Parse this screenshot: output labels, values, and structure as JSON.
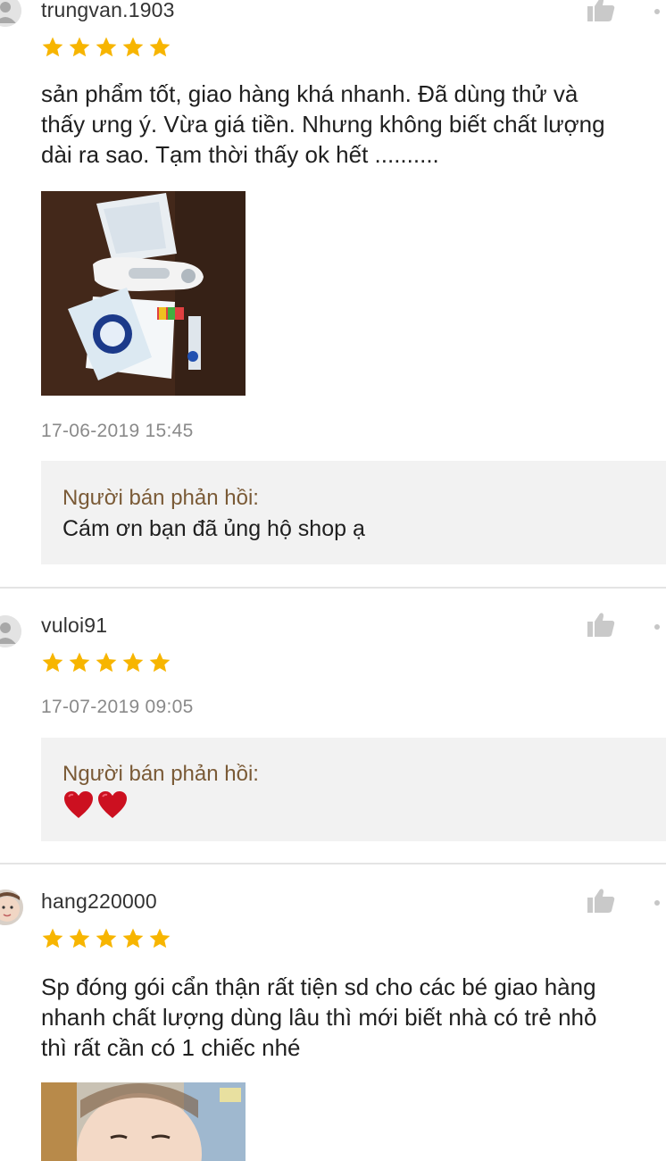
{
  "colors": {
    "star": "#f7b500",
    "seller_label": "#7a5a36",
    "timestamp": "#8a8a8a",
    "seller_box_bg": "#f2f2f2",
    "heart": "#cc1020"
  },
  "reviews": [
    {
      "username": "trungvan.1903",
      "rating": 5,
      "comment_lines": [
        "sản phẩm tốt, giao hàng khá nhanh. Đã dùng thử và",
        "thấy ưng ý. Vừa giá tiền. Nhưng không biết chất lượng",
        "dài ra sao. Tạm thời thấy ok hết .........."
      ],
      "photo_icon": "thermometer-product-photo",
      "timestamp": "17-06-2019 15:45",
      "seller_reply": {
        "label": "Người bán phản hồi:",
        "text": "Cám ơn bạn đã ủng hộ shop ạ"
      }
    },
    {
      "username": "vuloi91",
      "rating": 5,
      "timestamp": "17-07-2019 09:05",
      "seller_reply": {
        "label": "Người bán phản hồi:",
        "hearts": 2,
        "heart_icon": "heart-icon"
      }
    },
    {
      "username": "hang220000",
      "rating": 5,
      "comment_lines": [
        "Sp đóng gói cẩn thận rất tiện sd cho các bé giao hàng",
        "nhanh chất lượng dùng lâu thì mới biết nhà có trẻ nhỏ",
        "thì rất cần có 1 chiếc nhé"
      ],
      "photo_icon": "baby-photo"
    }
  ]
}
